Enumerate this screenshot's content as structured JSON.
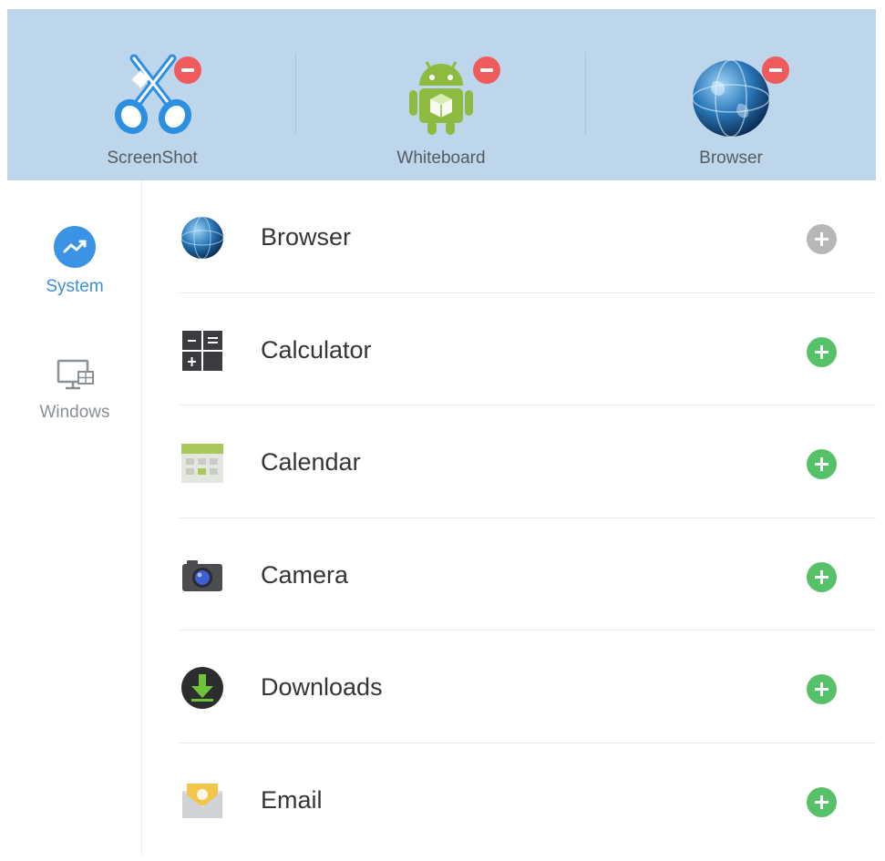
{
  "favorites": [
    {
      "label": "ScreenShot",
      "icon": "scissors-icon"
    },
    {
      "label": "Whiteboard",
      "icon": "android-icon"
    },
    {
      "label": "Browser",
      "icon": "globe-icon"
    }
  ],
  "sidebar": {
    "items": [
      {
        "label": "System",
        "icon": "trend-icon",
        "active": true
      },
      {
        "label": "Windows",
        "icon": "monitor-icon",
        "active": false
      }
    ]
  },
  "apps": [
    {
      "label": "Browser",
      "icon": "globe-icon",
      "added": true
    },
    {
      "label": "Calculator",
      "icon": "calculator-icon",
      "added": false
    },
    {
      "label": "Calendar",
      "icon": "calendar-icon",
      "added": false
    },
    {
      "label": "Camera",
      "icon": "camera-icon",
      "added": false
    },
    {
      "label": "Downloads",
      "icon": "download-icon",
      "added": false
    },
    {
      "label": "Email",
      "icon": "email-icon",
      "added": false
    }
  ],
  "colors": {
    "header_bg": "#bdd6ec",
    "accent": "#3b93e6",
    "add": "#57c16a",
    "remove": "#ef5b5b",
    "disabled": "#b5b7b9"
  }
}
